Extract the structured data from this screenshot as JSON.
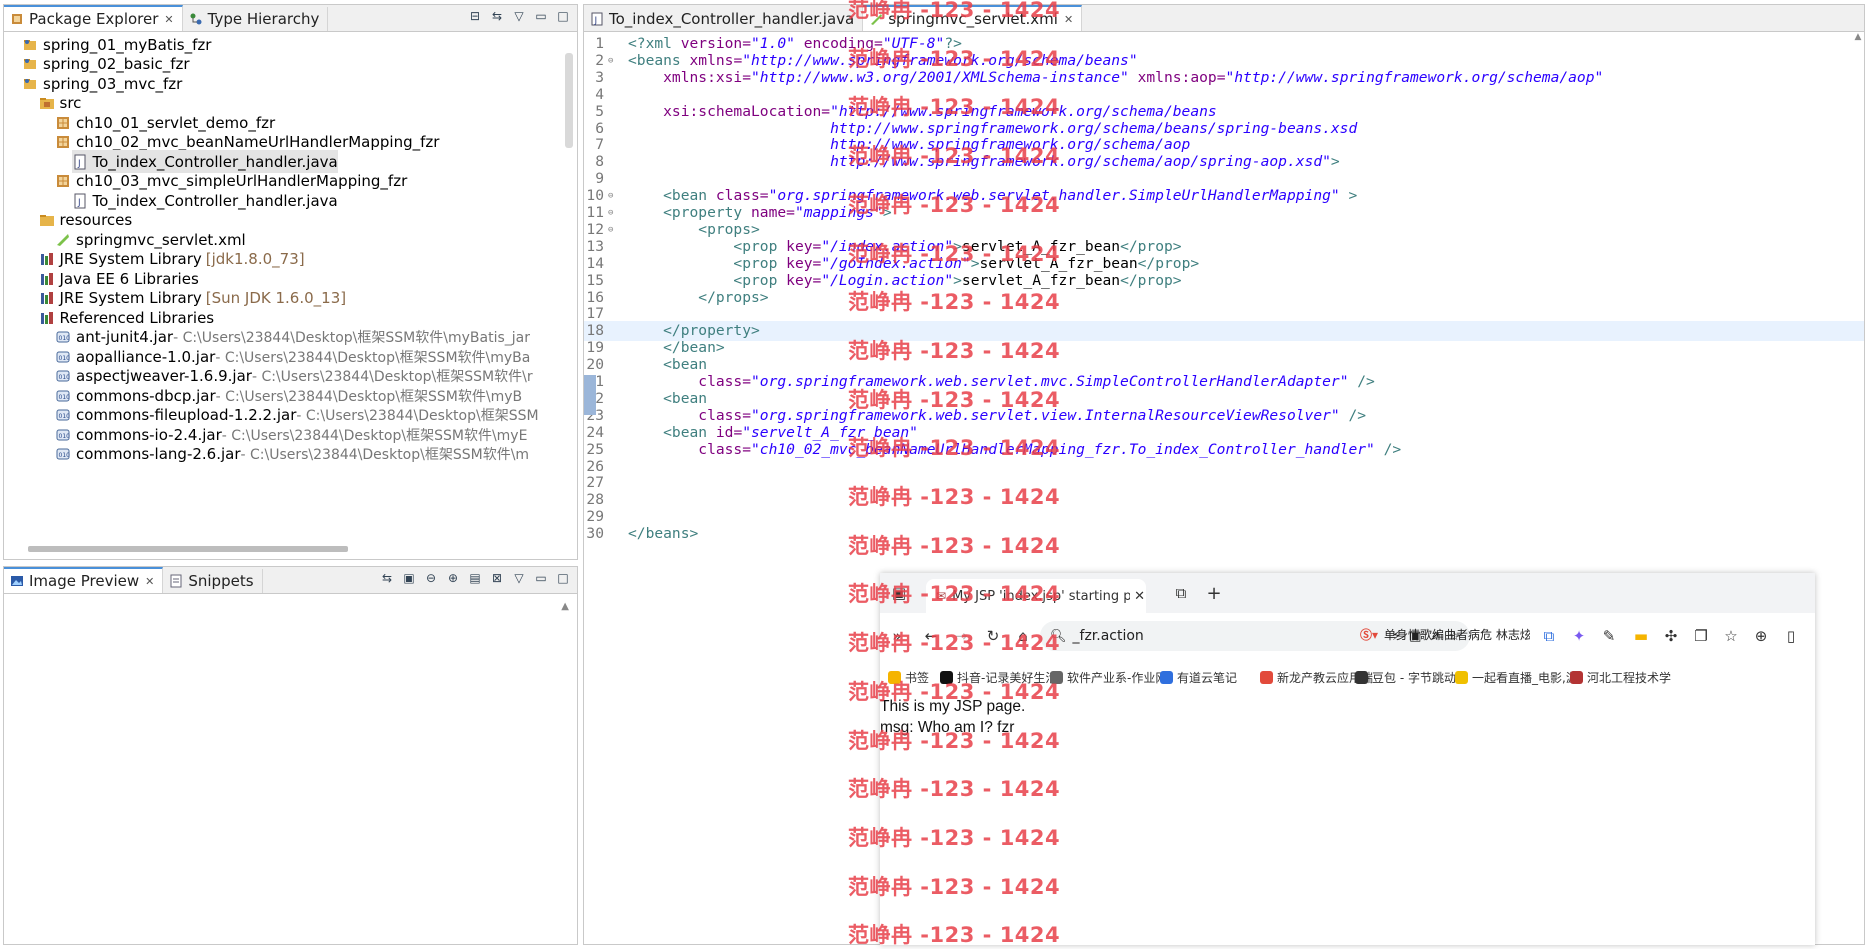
{
  "package_explorer": {
    "tabs": [
      {
        "label": "Package Explorer",
        "icon": "package-icon"
      },
      {
        "label": "Type Hierarchy",
        "icon": "hierarchy-icon"
      }
    ],
    "tree": [
      {
        "label": "spring_01_myBatis_fzr",
        "icon": "project-icon",
        "level": 0
      },
      {
        "label": "spring_02_basic_fzr",
        "icon": "project-icon",
        "level": 0
      },
      {
        "label": "spring_03_mvc_fzr",
        "icon": "project-icon",
        "level": 0
      },
      {
        "label": "src",
        "icon": "source-folder-icon",
        "level": 1
      },
      {
        "label": "ch10_01_servlet_demo_fzr",
        "icon": "package-icon",
        "level": 2
      },
      {
        "label": "ch10_02_mvc_beanNameUrlHandlerMapping_fzr",
        "icon": "package-icon",
        "level": 2
      },
      {
        "label": "To_index_Controller_handler.java",
        "icon": "java-file-icon",
        "level": 3,
        "selected": true
      },
      {
        "label": "ch10_03_mvc_simpleUrlHandlerMapping_fzr",
        "icon": "package-icon",
        "level": 2
      },
      {
        "label": "To_index_Controller_handler.java",
        "icon": "java-file-icon",
        "level": 3
      },
      {
        "label": "resources",
        "icon": "folder-icon",
        "level": 1
      },
      {
        "label": "springmvc_servlet.xml",
        "icon": "xml-file-icon",
        "level": 2
      },
      {
        "label": "JRE System Library",
        "extra": "[jdk1.8.0_73]",
        "icon": "library-icon",
        "level": 1
      },
      {
        "label": "Java EE 6 Libraries",
        "icon": "library-icon",
        "level": 1
      },
      {
        "label": "JRE System Library",
        "extra": "[Sun JDK 1.6.0_13]",
        "icon": "library-icon",
        "level": 1
      },
      {
        "label": "Referenced Libraries",
        "icon": "library-icon",
        "level": 1
      },
      {
        "label": "ant-junit4.jar",
        "path": " - C:\\Users\\23844\\Desktop\\框架SSM软件\\myBatis_jar",
        "icon": "jar-icon",
        "level": 2
      },
      {
        "label": "aopalliance-1.0.jar",
        "path": " - C:\\Users\\23844\\Desktop\\框架SSM软件\\myBa",
        "icon": "jar-icon",
        "level": 2
      },
      {
        "label": "aspectjweaver-1.6.9.jar",
        "path": " - C:\\Users\\23844\\Desktop\\框架SSM软件\\r",
        "icon": "jar-icon",
        "level": 2
      },
      {
        "label": "commons-dbcp.jar",
        "path": " - C:\\Users\\23844\\Desktop\\框架SSM软件\\myB",
        "icon": "jar-icon",
        "level": 2
      },
      {
        "label": "commons-fileupload-1.2.2.jar",
        "path": " - C:\\Users\\23844\\Desktop\\框架SSM",
        "icon": "jar-icon",
        "level": 2
      },
      {
        "label": "commons-io-2.4.jar",
        "path": " - C:\\Users\\23844\\Desktop\\框架SSM软件\\myE",
        "icon": "jar-icon",
        "level": 2
      },
      {
        "label": "commons-lang-2.6.jar",
        "path": " - C:\\Users\\23844\\Desktop\\框架SSM软件\\m",
        "icon": "jar-icon",
        "level": 2
      }
    ]
  },
  "image_preview": {
    "tabs": [
      {
        "label": "Image Preview",
        "icon": "image-icon"
      },
      {
        "label": "Snippets",
        "icon": "snippets-icon"
      }
    ]
  },
  "editor": {
    "tabs": [
      {
        "label": "To_index_Controller_handler.java",
        "icon": "java-file-icon",
        "active": false
      },
      {
        "label": "springmvc_servlet.xml",
        "icon": "xml-file-icon",
        "active": true
      }
    ],
    "current_line": 18,
    "lines": [
      [
        {
          "t": "tag",
          "v": "<?xml "
        },
        {
          "t": "att",
          "v": "version="
        },
        {
          "t": "val",
          "v": "\"1.0\""
        },
        {
          "t": "att",
          "v": " encoding="
        },
        {
          "t": "val",
          "v": "\"UTF-8\""
        },
        {
          "t": "tag",
          "v": "?>"
        }
      ],
      [
        {
          "t": "tag",
          "v": "<beans "
        },
        {
          "t": "att",
          "v": "xmlns="
        },
        {
          "t": "val",
          "v": "\"http://www.springframework.org/schema/beans\""
        }
      ],
      [
        {
          "t": "att",
          "v": "    xmlns:xsi="
        },
        {
          "t": "val",
          "v": "\"http://www.w3.org/2001/XMLSchema-instance\""
        },
        {
          "t": "att",
          "v": " xmlns:aop="
        },
        {
          "t": "val",
          "v": "\"http://www.springframework.org/schema/aop\""
        }
      ],
      [],
      [
        {
          "t": "att",
          "v": "    xsi:schemaLocation="
        },
        {
          "t": "val",
          "v": "\"http://www.springframework.org/schema/beans"
        }
      ],
      [
        {
          "t": "val",
          "v": "                       http://www.springframework.org/schema/beans/spring-beans.xsd"
        }
      ],
      [
        {
          "t": "val",
          "v": "                       http://www.springframework.org/schema/aop"
        }
      ],
      [
        {
          "t": "val",
          "v": "                       http://www.springframework.org/schema/aop/spring-aop.xsd\""
        },
        {
          "t": "tag",
          "v": ">"
        }
      ],
      [],
      [
        {
          "t": "tag",
          "v": "    <bean "
        },
        {
          "t": "att",
          "v": "class="
        },
        {
          "t": "val",
          "v": "\"org.springframework.web.servlet.handler.SimpleUrlHandlerMapping\""
        },
        {
          "t": "tag",
          "v": " >"
        }
      ],
      [
        {
          "t": "tag",
          "v": "    <property "
        },
        {
          "t": "att",
          "v": "name="
        },
        {
          "t": "val",
          "v": "\"mappings\""
        },
        {
          "t": "tag",
          "v": ">"
        }
      ],
      [
        {
          "t": "tag",
          "v": "        <props>"
        }
      ],
      [
        {
          "t": "tag",
          "v": "            <prop "
        },
        {
          "t": "att",
          "v": "key="
        },
        {
          "t": "val",
          "v": "\"/index.action\""
        },
        {
          "t": "tag",
          "v": ">"
        },
        {
          "t": "txt",
          "v": "servlet_A_fzr_bean"
        },
        {
          "t": "tag",
          "v": "</prop>"
        }
      ],
      [
        {
          "t": "tag",
          "v": "            <prop "
        },
        {
          "t": "att",
          "v": "key="
        },
        {
          "t": "val",
          "v": "\"/goIndex.action\""
        },
        {
          "t": "tag",
          "v": ">"
        },
        {
          "t": "txt",
          "v": "servlet_A_fzr_bean"
        },
        {
          "t": "tag",
          "v": "</prop>"
        }
      ],
      [
        {
          "t": "tag",
          "v": "            <prop "
        },
        {
          "t": "att",
          "v": "key="
        },
        {
          "t": "val",
          "v": "\"/Login.action\""
        },
        {
          "t": "tag",
          "v": ">"
        },
        {
          "t": "txt",
          "v": "servlet_A_fzr_bean"
        },
        {
          "t": "tag",
          "v": "</prop>"
        }
      ],
      [
        {
          "t": "tag",
          "v": "        </props>"
        }
      ],
      [],
      [
        {
          "t": "tag",
          "v": "    </property>"
        }
      ],
      [
        {
          "t": "tag",
          "v": "    </bean>"
        }
      ],
      [
        {
          "t": "tag",
          "v": "    <bean"
        }
      ],
      [
        {
          "t": "att",
          "v": "        class="
        },
        {
          "t": "val",
          "v": "\"org.springframework.web.servlet.mvc.SimpleControllerHandlerAdapter\""
        },
        {
          "t": "tag",
          "v": " />"
        }
      ],
      [
        {
          "t": "tag",
          "v": "    <bean"
        }
      ],
      [
        {
          "t": "att",
          "v": "        class="
        },
        {
          "t": "val",
          "v": "\"org.springframework.web.servlet.view.InternalResourceViewResolver\""
        },
        {
          "t": "tag",
          "v": " />"
        }
      ],
      [
        {
          "t": "tag",
          "v": "    <bean "
        },
        {
          "t": "att",
          "v": "id="
        },
        {
          "t": "val",
          "v": "\"servelt_A_fzr_bean\""
        }
      ],
      [
        {
          "t": "att",
          "v": "        class="
        },
        {
          "t": "val",
          "v": "\"ch10_02_mvc_beanNameUrlHandlerMapping_fzr.To_index_Controller_handler\""
        },
        {
          "t": "tag",
          "v": " />"
        }
      ],
      [],
      [],
      [],
      [],
      [
        {
          "t": "tag",
          "v": "</beans>"
        }
      ]
    ],
    "folds": [
      2,
      10,
      11,
      12
    ]
  },
  "watermark": {
    "text": "范峥冉 -123 - 1424",
    "color": "#e8404a"
  },
  "browser": {
    "tab_title": "My JSP 'index.jsp' starting pa",
    "new_tab": "+",
    "address": "_fzr.action",
    "search_hint": "单身情歌编曲者病危 林志炫",
    "bookmarks": [
      {
        "label": "书签",
        "color": "#f5b400"
      },
      {
        "label": "抖音-记录美好生活",
        "color": "#111111"
      },
      {
        "label": "软件产业系-作业网",
        "color": "#666666"
      },
      {
        "label": "有道云笔记",
        "color": "#2f6fde"
      },
      {
        "label": "新龙产教云应用端",
        "color": "#e24a3b"
      },
      {
        "label": "豆包 - 字节跳动旗",
        "color": "#333333"
      },
      {
        "label": "一起看直播_电影,游",
        "color": "#f0c000"
      },
      {
        "label": "河北工程技术学",
        "color": "#b33333"
      }
    ],
    "content": [
      "This is my JSP page.",
      "msg: Who am I? fzr"
    ]
  }
}
